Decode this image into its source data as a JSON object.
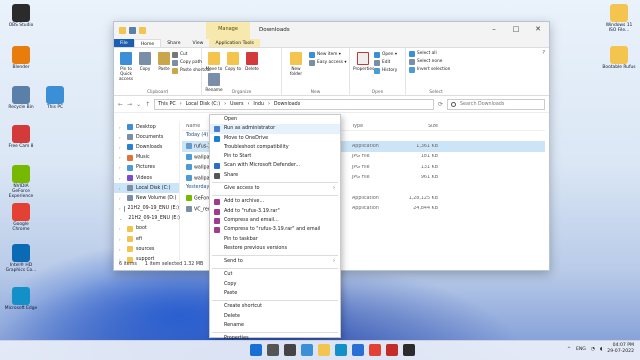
{
  "desktop_icons": [
    {
      "label": "OBS Studio",
      "color": "#2b2b2b"
    },
    {
      "label": "Blender",
      "color": "#e87d0d"
    },
    {
      "label": "Recycle Bin",
      "color": "#5a7fa8"
    },
    {
      "label": "This PC",
      "color": "#3b8fd6"
    },
    {
      "label": "Free Cam 8",
      "color": "#d33a3a"
    },
    {
      "label": "NVIDIA GeForce Experience",
      "color": "#76b900"
    },
    {
      "label": "Google Chrome",
      "color": "#e34133"
    },
    {
      "label": "Intel® HD Graphics Co...",
      "color": "#0b6ab4"
    },
    {
      "label": "Microsoft Edge",
      "color": "#1390c8"
    },
    {
      "label": "Windows 11 ISO File...",
      "color": "#f3c44e"
    },
    {
      "label": "Bootable Rufus",
      "color": "#f3c44e"
    }
  ],
  "window": {
    "title": "Downloads",
    "manage_label": "Manage",
    "tabs": [
      "File",
      "Home",
      "Share",
      "View",
      "Application Tools"
    ],
    "ribbon": {
      "clipboard": {
        "pin": "Pin to Quick access",
        "copy": "Copy",
        "paste": "Paste",
        "cut": "Cut",
        "copy_path": "Copy path",
        "paste_shortcut": "Paste shortcut",
        "group": "Clipboard"
      },
      "organize": {
        "move": "Move to",
        "copy": "Copy to",
        "delete": "Delete",
        "rename": "Rename",
        "group": "Organize"
      },
      "new": {
        "folder": "New folder",
        "item": "New item ▾",
        "easy": "Easy access ▾",
        "group": "New"
      },
      "open": {
        "props": "Properties",
        "open": "Open ▾",
        "edit": "Edit",
        "history": "History",
        "group": "Open"
      },
      "select": {
        "all": "Select all",
        "none": "Select none",
        "invert": "Invert selection",
        "group": "Select"
      }
    },
    "address": [
      "This PC",
      "Local Disk (C:)",
      "Users",
      "Indu",
      "Downloads"
    ],
    "search_placeholder": "Search Downloads",
    "nav": [
      {
        "label": "Desktop",
        "color": "#3b8fd6"
      },
      {
        "label": "Documents",
        "color": "#7a8ea8"
      },
      {
        "label": "Downloads",
        "color": "#2a7fd4"
      },
      {
        "label": "Music",
        "color": "#e2713a"
      },
      {
        "label": "Pictures",
        "color": "#4a9bd6"
      },
      {
        "label": "Videos",
        "color": "#7a4ad6"
      },
      {
        "label": "Local Disk (C:)",
        "color": "#7a8ea8"
      },
      {
        "label": "New Volume (D:)",
        "color": "#7a8ea8"
      },
      {
        "label": "21H2_09-19_ENU (E:)",
        "color": "#7a8ea8"
      },
      {
        "label": "21H2_09-19_ENU (E:)",
        "color": "#7a8ea8"
      },
      {
        "label": "boot",
        "color": "#f3c44e"
      },
      {
        "label": "efi",
        "color": "#f3c44e"
      },
      {
        "label": "sources",
        "color": "#f3c44e"
      },
      {
        "label": "support",
        "color": "#f3c44e"
      }
    ],
    "columns": [
      "Name",
      "Date modified",
      "Type",
      "Size"
    ],
    "group_today": "Today (4)",
    "group_yesterday": "Yesterday",
    "files": [
      {
        "name": "rufus-3.19.exe",
        "type": "Application",
        "size": "1,361 KB",
        "color": "#6a9bd0",
        "sel": true
      },
      {
        "name": "wallpaper",
        "type": "JPG File",
        "size": "181 KB",
        "color": "#4a9bd6",
        "sel": false
      },
      {
        "name": "wallpaper",
        "type": "JPG File",
        "size": "131 KB",
        "color": "#4a9bd6",
        "sel": false
      },
      {
        "name": "wallpaper",
        "type": "JPG File",
        "size": "961 KB",
        "color": "#4a9bd6",
        "sel": false
      },
      {
        "name": "GeForce",
        "type": "Application",
        "size": "1,28,125 KB",
        "color": "#76b900",
        "sel": false
      },
      {
        "name": "VC_redist",
        "type": "Application",
        "size": "24,844 KB",
        "color": "#7a8ea8",
        "sel": false
      }
    ],
    "status": [
      "6 items",
      "1 item selected  1.32 MB"
    ]
  },
  "context_menu": [
    {
      "label": "Open",
      "color": "",
      "hl": false,
      "sep_after": false,
      "arrow": false
    },
    {
      "label": "Run as administrator",
      "color": "#4a7fd0",
      "hl": true,
      "sep_after": false,
      "arrow": false
    },
    {
      "label": "Move to OneDrive",
      "color": "#1a7fd4",
      "hl": false,
      "sep_after": false,
      "arrow": false
    },
    {
      "label": "Troubleshoot compatibility",
      "color": "",
      "hl": false,
      "sep_after": false,
      "arrow": false
    },
    {
      "label": "Pin to Start",
      "color": "",
      "hl": false,
      "sep_after": false,
      "arrow": false
    },
    {
      "label": "Scan with Microsoft Defender...",
      "color": "#2b6cc4",
      "hl": false,
      "sep_after": false,
      "arrow": false
    },
    {
      "label": "Share",
      "color": "#555555",
      "hl": false,
      "sep_after": true,
      "arrow": false
    },
    {
      "label": "Give access to",
      "color": "",
      "hl": false,
      "sep_after": true,
      "arrow": true
    },
    {
      "label": "Add to archive...",
      "color": "#a33b8c",
      "hl": false,
      "sep_after": false,
      "arrow": false
    },
    {
      "label": "Add to \"rufus-3.19.rar\"",
      "color": "#a33b8c",
      "hl": false,
      "sep_after": false,
      "arrow": false
    },
    {
      "label": "Compress and email...",
      "color": "#a33b8c",
      "hl": false,
      "sep_after": false,
      "arrow": false
    },
    {
      "label": "Compress to \"rufus-3.19.rar\" and email",
      "color": "#a33b8c",
      "hl": false,
      "sep_after": false,
      "arrow": false
    },
    {
      "label": "Pin to taskbar",
      "color": "",
      "hl": false,
      "sep_after": false,
      "arrow": false
    },
    {
      "label": "Restore previous versions",
      "color": "",
      "hl": false,
      "sep_after": true,
      "arrow": false
    },
    {
      "label": "Send to",
      "color": "",
      "hl": false,
      "sep_after": true,
      "arrow": true
    },
    {
      "label": "Cut",
      "color": "",
      "hl": false,
      "sep_after": false,
      "arrow": false
    },
    {
      "label": "Copy",
      "color": "",
      "hl": false,
      "sep_after": false,
      "arrow": false
    },
    {
      "label": "Paste",
      "color": "",
      "hl": false,
      "sep_after": true,
      "arrow": false
    },
    {
      "label": "Create shortcut",
      "color": "",
      "hl": false,
      "sep_after": false,
      "arrow": false
    },
    {
      "label": "Delete",
      "color": "",
      "hl": false,
      "sep_after": false,
      "arrow": false
    },
    {
      "label": "Rename",
      "color": "",
      "hl": false,
      "sep_after": true,
      "arrow": false
    },
    {
      "label": "Properties",
      "color": "",
      "hl": false,
      "sep_after": false,
      "arrow": false
    }
  ],
  "taskbar": {
    "apps": [
      {
        "name": "start",
        "color": "#1a6fd4"
      },
      {
        "name": "search",
        "color": "#555555"
      },
      {
        "name": "task-view",
        "color": "#444444"
      },
      {
        "name": "widgets",
        "color": "#3b8fd6"
      },
      {
        "name": "explorer",
        "color": "#f3c44e"
      },
      {
        "name": "edge",
        "color": "#1390c8"
      },
      {
        "name": "store",
        "color": "#2a6fd4"
      },
      {
        "name": "chrome",
        "color": "#e34133"
      },
      {
        "name": "record",
        "color": "#c42b2b"
      },
      {
        "name": "obs",
        "color": "#2b2b2b"
      }
    ],
    "lang": "ENG",
    "time": "04:07 PM",
    "date": "29-07-2022"
  }
}
